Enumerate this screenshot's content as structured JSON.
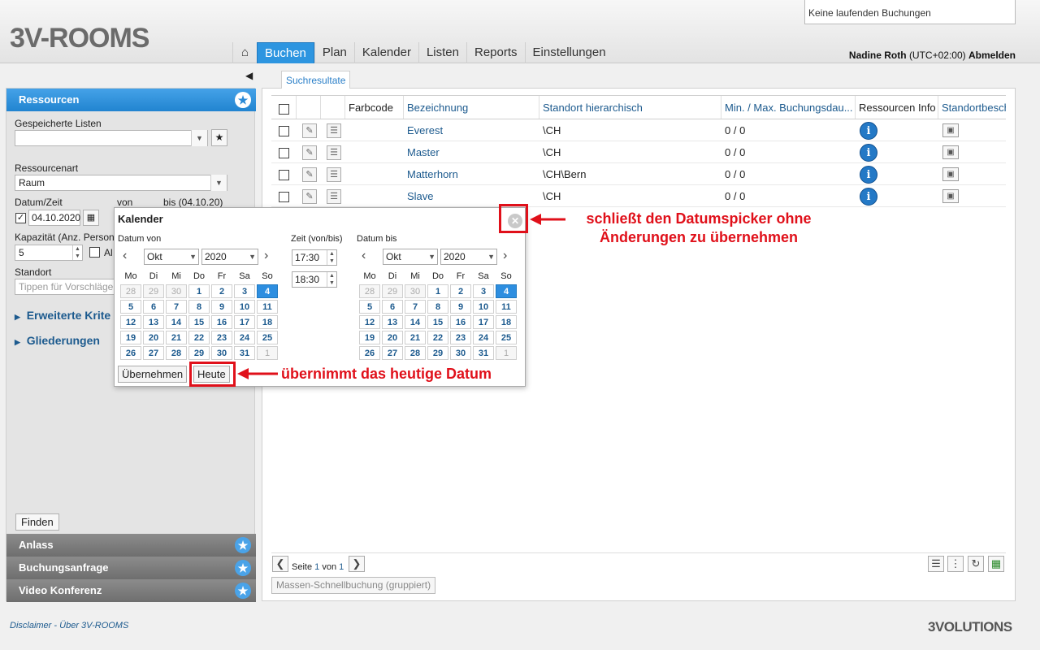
{
  "header": {
    "logo_text": "3V-ROOMS",
    "status": "Keine laufenden Buchungen",
    "nav": [
      "Buchen",
      "Plan",
      "Kalender",
      "Listen",
      "Reports",
      "Einstellungen"
    ],
    "user_name": "Nadine Roth",
    "timezone": "(UTC+02:00)",
    "logout": "Abmelden"
  },
  "sidebar": {
    "sections": {
      "ressourcen": "Ressourcen",
      "anlass": "Anlass",
      "buchungsanfrage": "Buchungsanfrage",
      "video": "Video Konferenz"
    },
    "gespeicherte_listen_label": "Gespeicherte Listen",
    "ressourcenart_label": "Ressourcenart",
    "ressourcenart_value": "Raum",
    "datum_zeit_label": "Datum/Zeit",
    "von_label": "von",
    "bis_label": "bis (04.10.20)",
    "date_value": "04.10.2020",
    "kapazitaet_label": "Kapazität (Anz. Persone",
    "kapazitaet_value": "5",
    "alle_label": "Al",
    "standort_label": "Standort",
    "standort_placeholder": "Tippen für Vorschläge",
    "erweiterte": "Erweiterte Krite",
    "gliederungen": "Gliederungen",
    "finden": "Finden"
  },
  "main": {
    "tab": "Suchresultate",
    "columns": {
      "farbcode": "Farbcode",
      "bezeichnung": "Bezeichnung",
      "standort": "Standort hierarchisch",
      "dauer": "Min. / Max. Buchungsdau...",
      "info": "Ressourcen Info",
      "standortbeschr": "Standortbeschr"
    },
    "rows": [
      {
        "name": "Everest",
        "standort": "\\CH",
        "dauer": "0 / 0"
      },
      {
        "name": "Master",
        "standort": "\\CH",
        "dauer": "0 / 0"
      },
      {
        "name": "Matterhorn",
        "standort": "\\CH\\Bern",
        "dauer": "0 / 0"
      },
      {
        "name": "Slave",
        "standort": "\\CH",
        "dauer": "0 / 0"
      }
    ],
    "pager": {
      "seite": "Seite",
      "current": "1",
      "von": "von",
      "total": "1"
    },
    "mass_button": "Massen-Schnellbuchung (gruppiert)"
  },
  "calendar": {
    "title": "Kalender",
    "datum_von": "Datum von",
    "zeit": "Zeit (von/bis)",
    "datum_bis": "Datum bis",
    "month": "Okt",
    "year": "2020",
    "weekdays": [
      "Mo",
      "Di",
      "Mi",
      "Do",
      "Fr",
      "Sa",
      "So"
    ],
    "days": [
      [
        "28",
        "29",
        "30",
        "1",
        "2",
        "3",
        "4"
      ],
      [
        "5",
        "6",
        "7",
        "8",
        "9",
        "10",
        "11"
      ],
      [
        "12",
        "13",
        "14",
        "15",
        "16",
        "17",
        "18"
      ],
      [
        "19",
        "20",
        "21",
        "22",
        "23",
        "24",
        "25"
      ],
      [
        "26",
        "27",
        "28",
        "29",
        "30",
        "31",
        "1"
      ]
    ],
    "time_from": "17:30",
    "time_to": "18:30",
    "apply": "Übernehmen",
    "today": "Heute"
  },
  "annotations": {
    "close_note_line1": "schließt den Datumspicker ohne",
    "close_note_line2": "Änderungen zu übernehmen",
    "today_note": "übernimmt das heutige Datum"
  },
  "footer": {
    "disclaimer": "Disclaimer",
    "separator": "-",
    "about": "Über 3V-ROOMS",
    "brand": "3VOLUTIONS"
  },
  "colors": {
    "accent": "#2d95e0",
    "annotation": "#e0101a"
  }
}
